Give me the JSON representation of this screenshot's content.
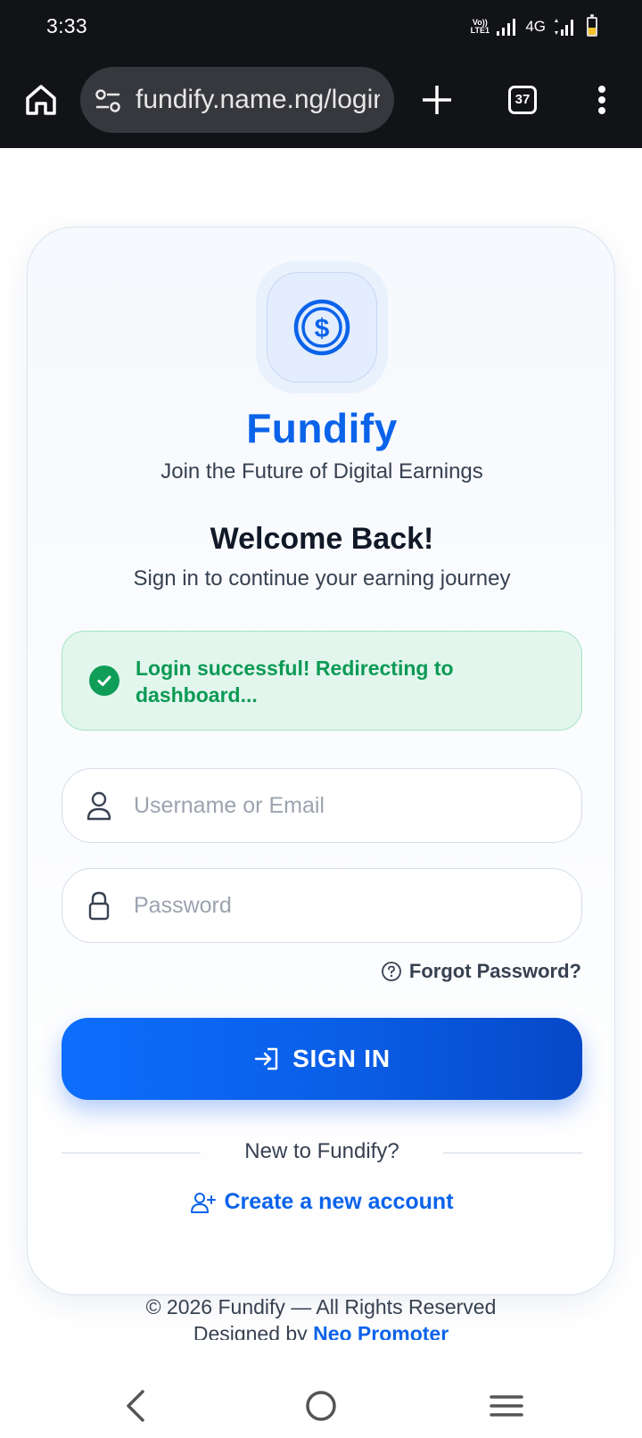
{
  "status_bar": {
    "time": "3:33",
    "volte_top": "Vo))",
    "volte_bottom": "LTE1",
    "network": "4G"
  },
  "browser": {
    "url": "fundify.name.ng/login",
    "tab_count": "37"
  },
  "login": {
    "brand": "Fundify",
    "tagline": "Join the Future of Digital Earnings",
    "heading": "Welcome Back!",
    "subheading": "Sign in to continue your earning journey",
    "alert_message": "Login successful! Redirecting to dashboard...",
    "username_placeholder": "Username or Email",
    "password_placeholder": "Password",
    "forgot_label": "Forgot Password?",
    "signin_label": "SIGN IN",
    "new_user_text": "New to Fundify?",
    "create_account_label": "Create a new account"
  },
  "footer": {
    "copyright": "© 2026 Fundify — All Rights Reserved",
    "designed_prefix": "Designed by",
    "designer": "Neo Promoter"
  },
  "icons": {
    "logo": "dollar-coin-icon",
    "alert": "check-circle-icon",
    "username": "user-icon",
    "password": "lock-icon",
    "forgot": "help-circle-icon",
    "signin": "login-icon",
    "create": "user-plus-icon"
  },
  "colors": {
    "brand_blue": "#0b63ea",
    "success_green": "#0c9a55",
    "alert_bg": "#e3f6ee"
  }
}
